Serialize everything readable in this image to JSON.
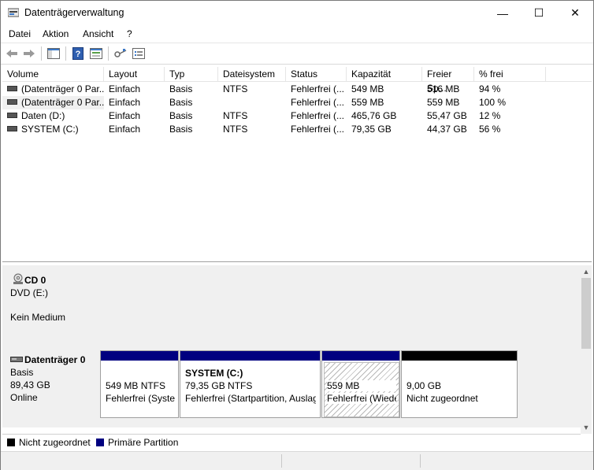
{
  "window": {
    "title": "Datenträgerverwaltung",
    "minimize": "—",
    "maximize": "☐",
    "close": "✕"
  },
  "menu": [
    "Datei",
    "Aktion",
    "Ansicht",
    "?"
  ],
  "columns": [
    "Volume",
    "Layout",
    "Typ",
    "Dateisystem",
    "Status",
    "Kapazität",
    "Freier Sp...",
    "% frei"
  ],
  "volumes": [
    [
      "(Datenträger 0 Par...",
      "Einfach",
      "Basis",
      "NTFS",
      "Fehlerfrei (...",
      "549 MB",
      "516 MB",
      "94 %"
    ],
    [
      "(Datenträger 0 Par...",
      "Einfach",
      "Basis",
      "",
      "Fehlerfrei (...",
      "559 MB",
      "559 MB",
      "100 %"
    ],
    [
      "Daten (D:)",
      "Einfach",
      "Basis",
      "NTFS",
      "Fehlerfrei (...",
      "465,76 GB",
      "55,47 GB",
      "12 %"
    ],
    [
      "SYSTEM (C:)",
      "Einfach",
      "Basis",
      "NTFS",
      "Fehlerfrei (...",
      "79,35 GB",
      "44,37 GB",
      "56 %"
    ]
  ],
  "cd": {
    "name": "CD 0",
    "drive": "DVD (E:)",
    "media": "Kein Medium"
  },
  "disk0": {
    "name": "Datenträger 0",
    "type": "Basis",
    "size": "89,43 GB",
    "state": "Online"
  },
  "partitions": [
    {
      "name": "",
      "size": "549 MB NTFS",
      "status": "Fehlerfrei (Syste"
    },
    {
      "name": "SYSTEM  (C:)",
      "size": "79,35 GB NTFS",
      "status": "Fehlerfrei (Startpartition, Auslag"
    },
    {
      "name": "",
      "size": "559 MB",
      "status": "Fehlerfrei (Wiede"
    },
    {
      "name": "",
      "size": "9,00 GB",
      "status": "Nicht zugeordnet"
    }
  ],
  "legend": {
    "unallocated": "Nicht zugeordnet",
    "primary": "Primäre Partition"
  },
  "colors": {
    "primary": "#000080",
    "unallocated": "#000000"
  }
}
